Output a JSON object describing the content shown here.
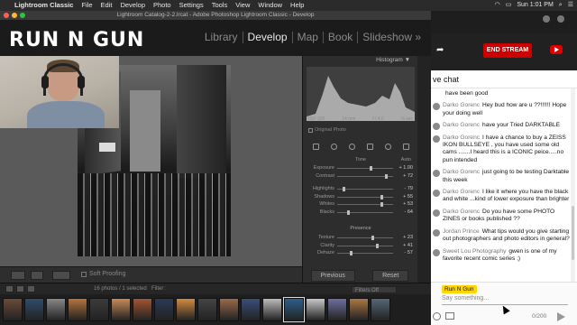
{
  "menubar": {
    "app": "Lightroom Classic",
    "items": [
      "File",
      "Edit",
      "Develop",
      "Photo",
      "Settings",
      "Tools",
      "View",
      "Window",
      "Help"
    ],
    "clock": "Sun 1:01 PM"
  },
  "lightroom": {
    "window_title": "Lightroom Catalog-2-2.lrcat - Adobe Photoshop Lightroom Classic - Develop",
    "logo": "RUN N GUN",
    "modules": [
      "Library",
      "Develop",
      "Map",
      "Book",
      "Slideshow »"
    ],
    "active_module": "Develop",
    "histogram_label": "Histogram ▼",
    "exif": [
      "ISO 320",
      "14 mm",
      "f / 4.0",
      "⅛ sec"
    ],
    "original_photo": "Original Photo",
    "tone_label": "Tone",
    "auto_label": "Auto",
    "tone_sliders": [
      {
        "label": "Exposure",
        "value": "+ 1.00",
        "pos": 0.58
      },
      {
        "label": "Contrast",
        "value": "+ 72",
        "pos": 0.86
      },
      {
        "label": "Highlights",
        "value": "- 79",
        "pos": 0.1
      },
      {
        "label": "Shadows",
        "value": "+ 55",
        "pos": 0.78
      },
      {
        "label": "Whites",
        "value": "+ 53",
        "pos": 0.77
      },
      {
        "label": "Blacks",
        "value": "- 64",
        "pos": 0.18
      }
    ],
    "presence_label": "Presence",
    "presence_sliders": [
      {
        "label": "Texture",
        "value": "+ 23",
        "pos": 0.62
      },
      {
        "label": "Clarity",
        "value": "+ 41",
        "pos": 0.7
      },
      {
        "label": "Dehaze",
        "value": "- 57",
        "pos": 0.22
      }
    ],
    "previous_button": "Previous",
    "reset_button": "Reset",
    "soft_proofing": "Soft Proofing",
    "photo_count": "16 photos / 1 selected",
    "filter_label": "Filter :",
    "filters_off": "Filters Off"
  },
  "chat": {
    "end_stream": "END STREAM",
    "header": "ve chat",
    "messages": [
      {
        "author": "",
        "text": "have been good"
      },
      {
        "author": "Darko Gorenc",
        "text": "Hey bud how are u ??!!!!!!  Hope your doing well"
      },
      {
        "author": "Darko Gorenc",
        "text": "have your Tried DARKTABLE"
      },
      {
        "author": "Darko Gorenc",
        "text": "I have a chance to buy a ZEISS IKON BULLSEYE , you have used some old cams .......I heard this is a ICONIC peice.....no pun intended"
      },
      {
        "author": "Darko Gorenc",
        "text": "just going to be testing Darktable this week"
      },
      {
        "author": "Darko Gorenc",
        "text": "I like it where you have the black and white ...kind of lower exposure than brighter"
      },
      {
        "author": "Darko Gorenc",
        "text": "Do you have some PHOTO ZINES or books published ??"
      },
      {
        "author": "Jordan Prince",
        "text": "What tips would you give starting out photographers and photo editors in general?"
      },
      {
        "author": "Sweet Lou Photography",
        "text": "gwen is one of my favorite recent comic series ;)"
      }
    ],
    "composer_name": "Run N Gun",
    "placeholder": "Say something...",
    "char_count": "0/200"
  }
}
